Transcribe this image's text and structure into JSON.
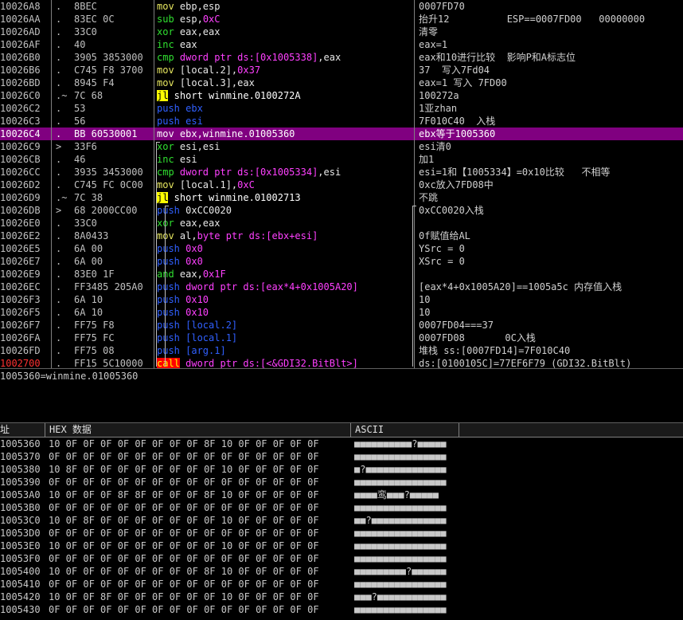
{
  "disasm": {
    "rows": [
      {
        "addr": "10026A8",
        "mark": ".",
        "hex": "8BEC",
        "asm": [
          [
            "mn-mov",
            "mov "
          ],
          [
            "op",
            "ebp,esp"
          ]
        ],
        "cmt": "0007FD70"
      },
      {
        "addr": "10026AA",
        "mark": ".",
        "hex": "83EC 0C",
        "asm": [
          [
            "mn-arith",
            "sub "
          ],
          [
            "op",
            "esp,"
          ],
          [
            "op-imm",
            "0xC"
          ]
        ],
        "cmt": "抬升12          ESP==0007FD00   00000000"
      },
      {
        "addr": "10026AD",
        "mark": ".",
        "hex": "33C0",
        "asm": [
          [
            "mn-arith",
            "xor "
          ],
          [
            "op",
            "eax,eax"
          ]
        ],
        "cmt": "清零"
      },
      {
        "addr": "10026AF",
        "mark": ".",
        "hex": "40",
        "asm": [
          [
            "mn-arith",
            "inc "
          ],
          [
            "op",
            "eax"
          ]
        ],
        "cmt": "eax=1"
      },
      {
        "addr": "10026B0",
        "mark": ".",
        "hex": "3905 3853000",
        "asm": [
          [
            "mn-arith",
            "cmp "
          ],
          [
            "mn-lea",
            "dword ptr ds:[0x1005338]"
          ],
          [
            "op",
            ",eax"
          ]
        ],
        "cmt": "eax和10进行比较  影响P和A标志位"
      },
      {
        "addr": "10026B6",
        "mark": ".",
        "hex": "C745 F8 3700",
        "asm": [
          [
            "mn-mov",
            "mov "
          ],
          [
            "op",
            "[local.2],"
          ],
          [
            "op-imm",
            "0x37"
          ]
        ],
        "cmt": "37  写入7Fd04"
      },
      {
        "addr": "10026BD",
        "mark": ".",
        "hex": "8945 F4",
        "asm": [
          [
            "mn-mov",
            "mov "
          ],
          [
            "op",
            "[local.3],eax"
          ]
        ],
        "cmt": "eax=1 写入 7FD00"
      },
      {
        "addr": "10026C0",
        "mark": ".~",
        "hex": "7C 68",
        "asm": [
          [
            "mn-jl",
            "jl"
          ],
          [
            "mn-text",
            " short winmine.0100272A"
          ]
        ],
        "cmt": "100272a"
      },
      {
        "addr": "10026C2",
        "mark": ".",
        "hex": "53",
        "asm": [
          [
            "mn-push",
            "push "
          ],
          [
            "mn-push",
            "ebx"
          ]
        ],
        "cmt": "1亚zhan"
      },
      {
        "addr": "10026C3",
        "mark": ".",
        "hex": "56",
        "asm": [
          [
            "mn-push",
            "push "
          ],
          [
            "mn-push",
            "esi"
          ]
        ],
        "cmt": "7F010C40  入栈"
      },
      {
        "addr": "10026C4",
        "mark": ".",
        "hex": "BB 60530001",
        "asm": [
          [
            "mn-text",
            "mov ebx,winmine.01005360"
          ]
        ],
        "cmt": "ebx等于1005360",
        "sel": true
      },
      {
        "addr": "10026C9",
        "mark": ">",
        "hex": "33F6",
        "asm": [
          [
            "mn-arith",
            "xor "
          ],
          [
            "op",
            "esi,esi"
          ]
        ],
        "cmt": "esi清0"
      },
      {
        "addr": "10026CB",
        "mark": ".",
        "hex": "46",
        "asm": [
          [
            "mn-arith",
            "inc "
          ],
          [
            "op",
            "esi"
          ]
        ],
        "cmt": "加1"
      },
      {
        "addr": "10026CC",
        "mark": ".",
        "hex": "3935 3453000",
        "asm": [
          [
            "mn-arith",
            "cmp "
          ],
          [
            "mn-lea",
            "dword ptr ds:[0x1005334]"
          ],
          [
            "op",
            ",esi"
          ]
        ],
        "cmt": "esi=1和【1005334】=0x10比较   不相等"
      },
      {
        "addr": "10026D2",
        "mark": ".",
        "hex": "C745 FC 0C00",
        "asm": [
          [
            "mn-mov",
            "mov "
          ],
          [
            "op",
            "[local.1],"
          ],
          [
            "op-imm",
            "0xC"
          ]
        ],
        "cmt": "0xc放入7FD08中"
      },
      {
        "addr": "10026D9",
        "mark": ".~",
        "hex": "7C 38",
        "asm": [
          [
            "mn-jl",
            "jl"
          ],
          [
            "mn-text",
            " short winmine.01002713"
          ]
        ],
        "cmt": "不跳"
      },
      {
        "addr": "10026DB",
        "mark": ">",
        "hex": "68 2000CC00",
        "asm": [
          [
            "mn-push",
            "push "
          ],
          [
            "op",
            "0xCC0020"
          ]
        ],
        "cmt": "0xCC0020入栈"
      },
      {
        "addr": "10026E0",
        "mark": ".",
        "hex": "33C0",
        "asm": [
          [
            "mn-arith",
            "xor "
          ],
          [
            "op",
            "eax,eax"
          ]
        ],
        "cmt": ""
      },
      {
        "addr": "10026E2",
        "mark": ".",
        "hex": "8A0433",
        "asm": [
          [
            "mn-mov",
            "mov "
          ],
          [
            "op",
            "al,"
          ],
          [
            "mn-lea",
            "byte ptr ds:[ebx+esi]"
          ]
        ],
        "cmt": "0f赋值给AL"
      },
      {
        "addr": "10026E5",
        "mark": ".",
        "hex": "6A 00",
        "asm": [
          [
            "mn-push",
            "push "
          ],
          [
            "op-imm",
            "0x0"
          ]
        ],
        "cmt": "YSrc = 0"
      },
      {
        "addr": "10026E7",
        "mark": ".",
        "hex": "6A 00",
        "asm": [
          [
            "mn-push",
            "push "
          ],
          [
            "op-imm",
            "0x0"
          ]
        ],
        "cmt": "XSrc = 0"
      },
      {
        "addr": "10026E9",
        "mark": ".",
        "hex": "83E0 1F",
        "asm": [
          [
            "mn-arith",
            "and "
          ],
          [
            "op",
            "eax,"
          ],
          [
            "op-imm",
            "0x1F"
          ]
        ],
        "cmt": ""
      },
      {
        "addr": "10026EC",
        "mark": ".",
        "hex": "FF3485 205A0",
        "asm": [
          [
            "mn-push",
            "push "
          ],
          [
            "mn-lea",
            "dword ptr ds:[eax*4+0x1005A20]"
          ]
        ],
        "cmt": "[eax*4+0x1005A20]==1005a5c 内存值入栈"
      },
      {
        "addr": "10026F3",
        "mark": ".",
        "hex": "6A 10",
        "asm": [
          [
            "mn-push",
            "push "
          ],
          [
            "op-imm",
            "0x10"
          ]
        ],
        "cmt": "10"
      },
      {
        "addr": "10026F5",
        "mark": ".",
        "hex": "6A 10",
        "asm": [
          [
            "mn-push",
            "push "
          ],
          [
            "op-imm",
            "0x10"
          ]
        ],
        "cmt": "10"
      },
      {
        "addr": "10026F7",
        "mark": ".",
        "hex": "FF75 F8",
        "asm": [
          [
            "mn-push",
            "push "
          ],
          [
            "mn-push",
            "[local.2]"
          ]
        ],
        "cmt": "0007FD04===37"
      },
      {
        "addr": "10026FA",
        "mark": ".",
        "hex": "FF75 FC",
        "asm": [
          [
            "mn-push",
            "push "
          ],
          [
            "mn-push",
            "[local.1]"
          ]
        ],
        "cmt": "0007FD08       0C入栈"
      },
      {
        "addr": "10026FD",
        "mark": ".",
        "hex": "FF75 08",
        "asm": [
          [
            "mn-push",
            "push "
          ],
          [
            "mn-push",
            "[arg.1]"
          ]
        ],
        "cmt": "堆栈 ss:[0007FD14]=7F010C40"
      },
      {
        "addr": "1002700",
        "mark": ".",
        "hex": "FF15 5C10000",
        "asm": [
          [
            "mn-call",
            "call"
          ],
          [
            "op",
            " "
          ],
          [
            "mn-lea",
            "dword ptr ds:[<&GDI32.BitBlt>]"
          ]
        ],
        "cmt": "ds:[0100105C]=77EF6F79 (GDI32.BitBlt)",
        "eip": true
      }
    ]
  },
  "info": {
    "line": "1005360=winmine.01005360"
  },
  "dump": {
    "header_addr": "址",
    "header_hex": "HEX 数据",
    "header_ascii": "ASCII",
    "rows": [
      {
        "addr": "1005360",
        "hex": "10 0F 0F 0F 0F 0F 0F 0F 0F 8F 10 0F 0F 0F 0F 0F",
        "ascii": "■■■■■■■■■■?■■■■■"
      },
      {
        "addr": "1005370",
        "hex": "0F 0F 0F 0F 0F 0F 0F 0F 0F 0F 0F 0F 0F 0F 0F 0F",
        "ascii": "■■■■■■■■■■■■■■■■"
      },
      {
        "addr": "1005380",
        "hex": "10 8F 0F 0F 0F 0F 0F 0F 0F 0F 10 0F 0F 0F 0F 0F",
        "ascii": "■?■■■■■■■■■■■■■■"
      },
      {
        "addr": "1005390",
        "hex": "0F 0F 0F 0F 0F 0F 0F 0F 0F 0F 0F 0F 0F 0F 0F 0F",
        "ascii": "■■■■■■■■■■■■■■■■"
      },
      {
        "addr": "10053A0",
        "hex": "10 0F 0F 0F 8F 8F 0F 0F 0F 8F 10 0F 0F 0F 0F 0F",
        "ascii": "■■■■鸾■■■?■■■■■"
      },
      {
        "addr": "10053B0",
        "hex": "0F 0F 0F 0F 0F 0F 0F 0F 0F 0F 0F 0F 0F 0F 0F 0F",
        "ascii": "■■■■■■■■■■■■■■■■"
      },
      {
        "addr": "10053C0",
        "hex": "10 0F 8F 0F 0F 0F 0F 0F 0F 0F 10 0F 0F 0F 0F 0F",
        "ascii": "■■?■■■■■■■■■■■■■"
      },
      {
        "addr": "10053D0",
        "hex": "0F 0F 0F 0F 0F 0F 0F 0F 0F 0F 0F 0F 0F 0F 0F 0F",
        "ascii": "■■■■■■■■■■■■■■■■"
      },
      {
        "addr": "10053E0",
        "hex": "10 0F 0F 0F 0F 0F 0F 0F 0F 0F 10 0F 0F 0F 0F 0F",
        "ascii": "■■■■■■■■■■■■■■■■"
      },
      {
        "addr": "10053F0",
        "hex": "0F 0F 0F 0F 0F 0F 0F 0F 0F 0F 0F 0F 0F 0F 0F 0F",
        "ascii": "■■■■■■■■■■■■■■■■"
      },
      {
        "addr": "1005400",
        "hex": "10 0F 0F 0F 0F 0F 0F 0F 0F 8F 10 0F 0F 0F 0F 0F",
        "ascii": "■■■■■■■■■?■■■■■■"
      },
      {
        "addr": "1005410",
        "hex": "0F 0F 0F 0F 0F 0F 0F 0F 0F 0F 0F 0F 0F 0F 0F 0F",
        "ascii": "■■■■■■■■■■■■■■■■"
      },
      {
        "addr": "1005420",
        "hex": "10 0F 0F 8F 0F 0F 0F 0F 0F 0F 10 0F 0F 0F 0F 0F",
        "ascii": "■■■?■■■■■■■■■■■■"
      },
      {
        "addr": "1005430",
        "hex": "0F 0F 0F 0F 0F 0F 0F 0F 0F 0F 0F 0F 0F 0F 0F 0F",
        "ascii": "■■■■■■■■■■■■■■■■"
      }
    ]
  }
}
